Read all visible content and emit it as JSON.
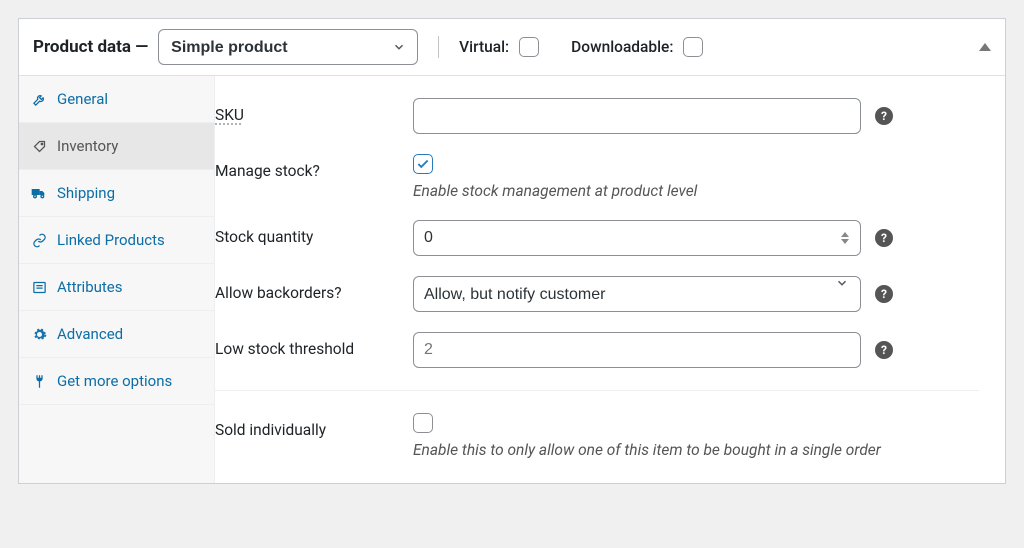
{
  "header": {
    "title": "Product data —",
    "product_type_selected": "Simple product",
    "virtual_label": "Virtual:",
    "downloadable_label": "Downloadable:"
  },
  "sidebar": {
    "items": [
      {
        "label": "General"
      },
      {
        "label": "Inventory"
      },
      {
        "label": "Shipping"
      },
      {
        "label": "Linked Products"
      },
      {
        "label": "Attributes"
      },
      {
        "label": "Advanced"
      },
      {
        "label": "Get more options"
      }
    ]
  },
  "fields": {
    "sku": {
      "label": "SKU",
      "value": ""
    },
    "manage_stock": {
      "label": "Manage stock?",
      "description": "Enable stock management at product level"
    },
    "stock_quantity": {
      "label": "Stock quantity",
      "value": "0"
    },
    "backorders": {
      "label": "Allow backorders?",
      "selected": "Allow, but notify customer"
    },
    "low_stock": {
      "label": "Low stock threshold",
      "placeholder": "2"
    },
    "sold_individually": {
      "label": "Sold individually",
      "description": "Enable this to only allow one of this item to be bought in a single order"
    }
  }
}
